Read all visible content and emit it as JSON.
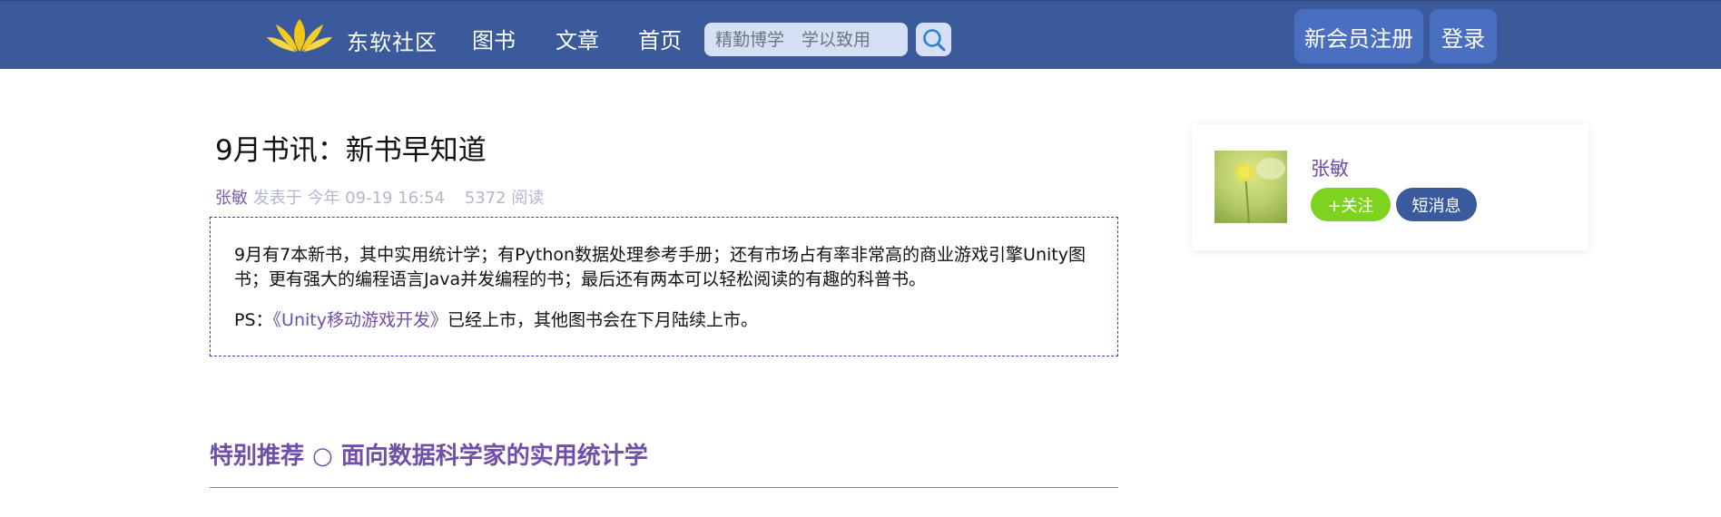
{
  "header": {
    "brand": "东软社区",
    "nav": {
      "books": "图书",
      "articles": "文章",
      "home": "首页"
    },
    "search": {
      "placeholder": "精勤博学　学以致用",
      "icon": "search-icon"
    },
    "register_label": "新会员注册",
    "login_label": "登录",
    "logo_icon": "lotus-logo-icon"
  },
  "article": {
    "title": "9月书讯：新书早知道",
    "author": "张敏",
    "posted_text": "发表于 今年 09-19 16:54",
    "views_text": "5372 阅读",
    "intro": {
      "paragraph1": "9月有7本新书，其中实用统计学；有Python数据处理参考手册；还有市场占有率非常高的商业游戏引擎Unity图书；更有强大的编程语言Java并发编程的书；最后还有两本可以轻松阅读的有趣的科普书。",
      "ps_prefix": "PS：",
      "ps_link": "《Unity移动游戏开发》",
      "ps_suffix": "已经上市，其他图书会在下月陆续上市。"
    },
    "section_heading": "特别推荐 ○ 面向数据科学家的实用统计学"
  },
  "author_card": {
    "name": "张敏",
    "follow_label": "+关注",
    "message_label": "短消息"
  },
  "colors": {
    "header_bg": "#3b5a9c",
    "header_button_bg": "#4a6fc0",
    "accent_purple": "#6f4fa8",
    "follow_green": "#7ed321",
    "logo_yellow": "#f3c515"
  }
}
